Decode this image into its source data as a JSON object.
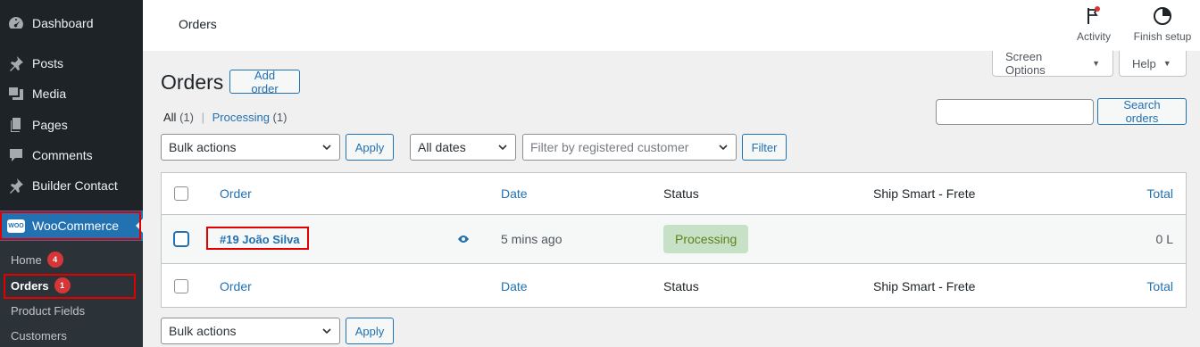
{
  "sidebar": {
    "items": [
      {
        "label": "Dashboard",
        "icon": "dashboard-icon"
      },
      {
        "label": "Posts",
        "icon": "pin-icon"
      },
      {
        "label": "Media",
        "icon": "media-icon"
      },
      {
        "label": "Pages",
        "icon": "pages-icon"
      },
      {
        "label": "Comments",
        "icon": "comment-icon"
      },
      {
        "label": "Builder Contact",
        "icon": "pin-icon"
      },
      {
        "label": "WooCommerce",
        "icon": "woo-logo-icon",
        "logo_text": "WOO"
      }
    ],
    "submenu": [
      {
        "label": "Home",
        "badge": "4"
      },
      {
        "label": "Orders",
        "badge": "1"
      },
      {
        "label": "Product Fields"
      },
      {
        "label": "Customers"
      }
    ]
  },
  "topbar": {
    "breadcrumb": "Orders",
    "activity_label": "Activity",
    "finish_setup_label": "Finish setup"
  },
  "screen_options_label": "Screen Options",
  "help_label": "Help",
  "page": {
    "title": "Orders",
    "add_order_label": "Add order"
  },
  "views": {
    "all_label": "All",
    "all_count": "(1)",
    "separator": "|",
    "processing_label": "Processing",
    "processing_count": "(1)"
  },
  "search": {
    "value": "",
    "button_label": "Search orders"
  },
  "filters": {
    "bulk_actions": "Bulk actions",
    "apply_label": "Apply",
    "dates": "All dates",
    "customer_placeholder": "Filter by registered customer",
    "filter_label": "Filter"
  },
  "table": {
    "columns": {
      "order": "Order",
      "date": "Date",
      "status": "Status",
      "shipping": "Ship Smart - Frete",
      "total": "Total"
    },
    "rows": [
      {
        "order": "#19 João Silva",
        "date": "5 mins ago",
        "status": "Processing",
        "shipping": "",
        "total": "0 L"
      }
    ]
  },
  "bottom": {
    "bulk_actions": "Bulk actions",
    "apply_label": "Apply"
  },
  "colors": {
    "sidebar_bg": "#1d2327",
    "accent": "#2271b1",
    "highlight_box": "#e00000",
    "status_processing_bg": "#c6e1c6",
    "status_processing_text": "#5b841b",
    "badge": "#d63638"
  }
}
